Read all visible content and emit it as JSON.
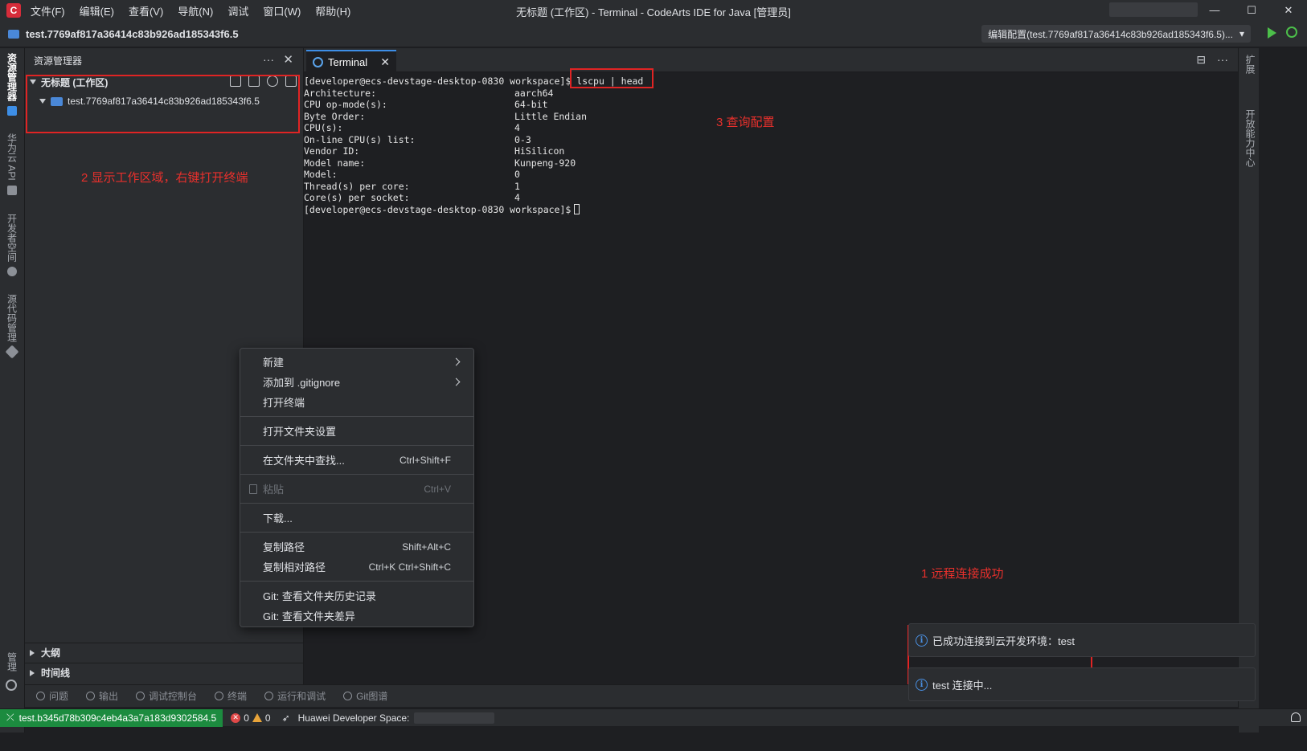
{
  "titlebar": {
    "menu": [
      "文件(F)",
      "编辑(E)",
      "查看(V)",
      "导航(N)",
      "调试",
      "窗口(W)",
      "帮助(H)"
    ],
    "title": "无标题 (工作区) - Terminal - CodeArts IDE for Java [管理员]",
    "controls": [
      "—",
      "☐",
      "✕"
    ]
  },
  "projectbar": {
    "project": "test.7769af817a36414c83b926ad185343f6.5",
    "run_config": "编辑配置(test.7769af817a36414c83b926ad185343f6.5)...",
    "run_config_arrow": "▾"
  },
  "activity_left": [
    "资源管理器",
    "华为云 API",
    "开发者空间",
    "源代码管理",
    "管理"
  ],
  "activity_right": [
    "扩展",
    "开放能力中心"
  ],
  "explorer": {
    "title": "资源管理器",
    "more": "···",
    "close": "✕",
    "workspace": "无标题 (工作区)",
    "folder": "test.7769af817a36414c83b926ad185343f6.5",
    "sections": [
      "大纲",
      "时间线"
    ]
  },
  "annotations": {
    "a1": "1 远程连接成功",
    "a2": "2 显示工作区域，右键打开终端",
    "a3": "3 查询配置"
  },
  "tab": {
    "label": "Terminal",
    "close": "✕"
  },
  "tab_tools": [
    "⊟",
    "···"
  ],
  "terminal": {
    "prompt": "[developer@ecs-devstage-desktop-0830 workspace]$",
    "command": " lscpu | head",
    "rows": [
      [
        "Architecture:",
        "aarch64"
      ],
      [
        "CPU op-mode(s):",
        "64-bit"
      ],
      [
        "Byte Order:",
        "Little Endian"
      ],
      [
        "CPU(s):",
        "4"
      ],
      [
        "On-line CPU(s) list:",
        "0-3"
      ],
      [
        "Vendor ID:",
        "HiSilicon"
      ],
      [
        "Model name:",
        "Kunpeng-920"
      ],
      [
        "Model:",
        "0"
      ],
      [
        "Thread(s) per core:",
        "1"
      ],
      [
        "Core(s) per socket:",
        "4"
      ]
    ],
    "final_prompt": "[developer@ecs-devstage-desktop-0830 workspace]$"
  },
  "context_menu": {
    "new": "新建",
    "add_gitignore": "添加到 .gitignore",
    "open_terminal": "打开终端",
    "folder_settings": "打开文件夹设置",
    "find_in_folder": "在文件夹中查找...",
    "find_in_folder_sc": "Ctrl+Shift+F",
    "paste": "粘贴",
    "paste_sc": "Ctrl+V",
    "download": "下载...",
    "copy_path": "复制路径",
    "copy_path_sc": "Shift+Alt+C",
    "copy_rel_path": "复制相对路径",
    "copy_rel_path_sc": "Ctrl+K Ctrl+Shift+C",
    "git_history": "Git: 查看文件夹历史记录",
    "git_diff": "Git: 查看文件夹差异"
  },
  "panel_tabs": [
    "问题",
    "输出",
    "调试控制台",
    "终端",
    "运行和调试",
    "Git图谱"
  ],
  "notifications": {
    "connected": "已成功连接到云开发环境：test",
    "connecting": "test 连接中..."
  },
  "statusbar": {
    "remote": "test.b345d78b309c4eb4a3a7a183d9302584.5",
    "errors": "0",
    "warnings": "0",
    "space_label": "Huawei Developer Space:"
  }
}
